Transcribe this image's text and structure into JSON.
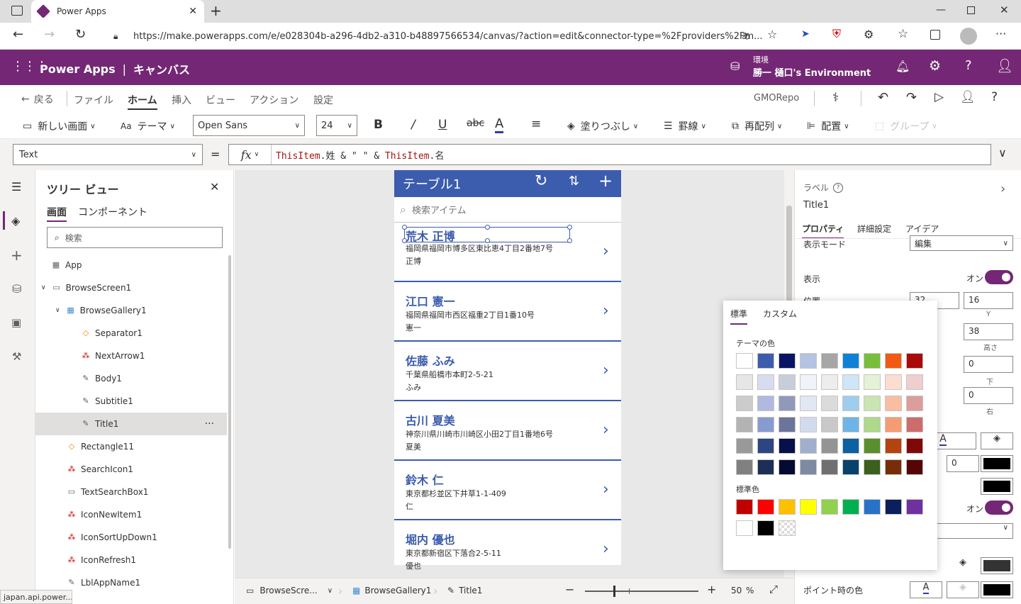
{
  "browser": {
    "tab_title": "Power Apps",
    "url": "https://make.powerapps.com/e/e028304b-a296-4db2-a310-b48897566534/canvas/?action=edit&connector-type=%2Fproviders%2Fm...",
    "status_url": "japan.api.power..."
  },
  "app": {
    "brand": "Power Apps",
    "separator": "|",
    "subtitle": "キャンバス",
    "env_label": "環境",
    "env_name": "勝一 樋口's Environment",
    "accent": "#742774"
  },
  "commands": {
    "back": "戻る",
    "items": [
      "ファイル",
      "ホーム",
      "挿入",
      "ビュー",
      "アクション",
      "設定"
    ],
    "active": "ホーム",
    "repo": "GMORepo"
  },
  "ribbon": {
    "new_screen": "新しい画面",
    "theme": "テーマ",
    "font": "Open Sans",
    "size": "24",
    "fill": "塗りつぶし",
    "border": "罫線",
    "reorder": "再配列",
    "align": "配置",
    "group": "グループ"
  },
  "formula": {
    "property": "Text",
    "equals": "=",
    "fx": "fx",
    "expr_1": "ThisItem",
    "expr_2": ".姓 & \" \" & ",
    "expr_3": "ThisItem",
    "expr_4": ".名"
  },
  "tree": {
    "title": "ツリー ビュー",
    "tab_screen": "画面",
    "tab_component": "コンポーネント",
    "search_placeholder": "検索",
    "items": [
      "App",
      "BrowseScreen1",
      "BrowseGallery1",
      "Separator1",
      "NextArrow1",
      "Body1",
      "Subtitle1",
      "Title1",
      "Rectangle11",
      "SearchIcon1",
      "TextSearchBox1",
      "IconNewItem1",
      "IconSortUpDown1",
      "IconRefresh1",
      "LblAppName1"
    ],
    "more": "···"
  },
  "gallery": {
    "header": "テーブル1",
    "search_placeholder": "検索アイテム",
    "items": [
      {
        "title": "荒木 正博",
        "subtitle": "福岡県福岡市博多区東比恵4丁目2番地7号",
        "body": "正博"
      },
      {
        "title": "江口 憲一",
        "subtitle": "福岡県福岡市西区福重2丁目1番10号",
        "body": "憲一"
      },
      {
        "title": "佐藤 ふみ",
        "subtitle": "千葉県船橋市本町2-5-21",
        "body": "ふみ"
      },
      {
        "title": "古川 夏美",
        "subtitle": "神奈川県川崎市川崎区小田2丁目1番地6号",
        "body": "夏美"
      },
      {
        "title": "鈴木 仁",
        "subtitle": "東京都杉並区下井草1-1-409",
        "body": "仁"
      },
      {
        "title": "堀内 優也",
        "subtitle": "東京都新宿区下落合2-5-11",
        "body": "優也"
      }
    ]
  },
  "statusbar": {
    "crumb1": "BrowseScre...",
    "crumb2": "BrowseGallery1",
    "crumb3": "Title1",
    "zoom": "50",
    "percent": "%"
  },
  "props": {
    "type": "ラベル",
    "name": "Title1",
    "tabs": [
      "プロパティ",
      "詳細設定",
      "アイデア"
    ],
    "display_mode_label": "表示モード",
    "display_mode_value": "編集",
    "visible_label": "表示",
    "visible_value": "オン",
    "position_label": "位置",
    "pos_x": "32",
    "pos_y": "16",
    "y_label": "Y",
    "height_value": "38",
    "height_label": "高さ",
    "pad_bottom_value": "0",
    "bottom_label": "下",
    "pad_right_value": "0",
    "right_label": "右",
    "border_value": "0",
    "autoheight_value": "オン",
    "hover_color_label": "ポイント時の色"
  },
  "picker": {
    "tab_standard": "標準",
    "tab_custom": "カスタム",
    "theme_label": "テーマの色",
    "standard_label": "標準色",
    "theme_colors": [
      [
        "#FFFFFF",
        "#3C5CAD",
        "#0A1464",
        "#B4C3E1",
        "#A6A6A6",
        "#0F82D7",
        "#78BE3C",
        "#F05A14",
        "#AA0A0A"
      ],
      [
        "#E6E6E6",
        "#D7DCF0",
        "#C8CDDC",
        "#F0F3F9",
        "#EDEDED",
        "#CFE6F7",
        "#E4F2D8",
        "#FCDED0",
        "#EECECE"
      ],
      [
        "#CCCCCC",
        "#AFB9E1",
        "#9199BB",
        "#E1E7F3",
        "#DBDBDB",
        "#9FCDEF",
        "#C9E5B1",
        "#F9BDA1",
        "#DD9D9D"
      ],
      [
        "#B3B3B3",
        "#879BD2",
        "#6C749B",
        "#D2DBED",
        "#C8C8C8",
        "#6FB4E7",
        "#AED88A",
        "#F69C72",
        "#CC6C6C"
      ],
      [
        "#999999",
        "#2D4582",
        "#07104B",
        "#A0B0CC",
        "#949494",
        "#0B61A1",
        "#5A8F2D",
        "#B4430F",
        "#800808"
      ],
      [
        "#808080",
        "#1E2E57",
        "#050A32",
        "#7D8AA2",
        "#707070",
        "#08416B",
        "#3C5F1E",
        "#782D0A",
        "#550505"
      ]
    ],
    "standard_colors": [
      "#C00000",
      "#FF0000",
      "#FFC000",
      "#FFFF00",
      "#92D050",
      "#00B050",
      "#2773C8",
      "#0A1F5C",
      "#7030A0"
    ],
    "extra_colors": [
      "#FFFFFF",
      "#000000",
      "transparent"
    ]
  }
}
